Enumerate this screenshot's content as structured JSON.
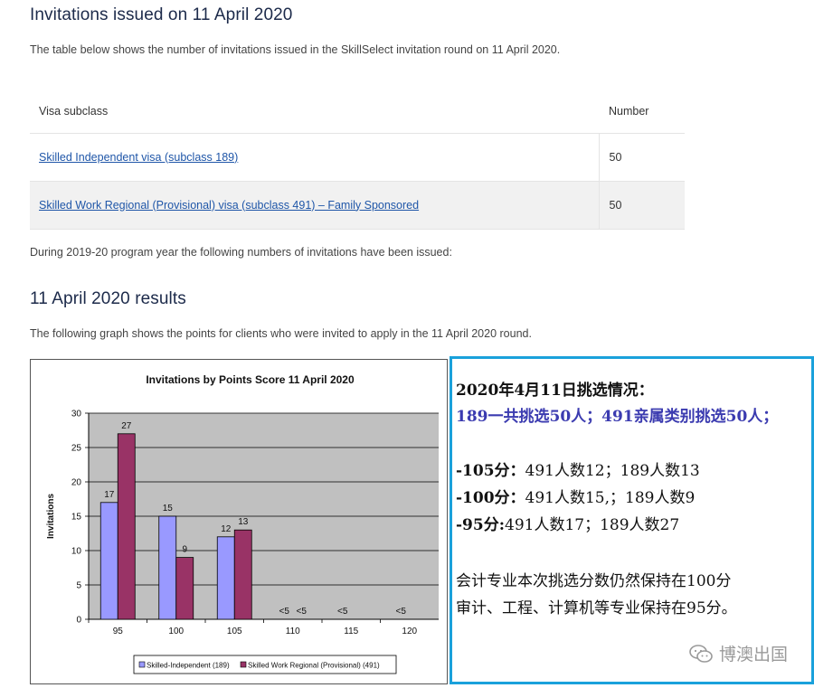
{
  "section1": {
    "title": "Invitations issued on 11 April 2020",
    "intro": "The table below shows the number of invitations issued in the SkillSelect invitation round on 11 April 2020.",
    "table": {
      "headers": [
        "Visa subclass",
        "Number"
      ],
      "rows": [
        {
          "visa": "Skilled Independent visa (subclass 189)",
          "number": "50"
        },
        {
          "visa": "Skilled Work Regional (Provisional) visa (subclass 491) – Family Sponsored",
          "number": "50"
        }
      ]
    },
    "program_note": "During 2019-20 program year the following numbers of invitations have been issued:"
  },
  "section2": {
    "title": "11 April 2020 results",
    "intro": "The following graph shows the points for clients who were invited to apply in the 11 April 2020 round."
  },
  "chart_data": {
    "type": "bar",
    "title": "Invitations by Points Score 11 April 2020",
    "ylabel": "Invitations",
    "xlabel": "",
    "ylim": [
      0,
      30
    ],
    "yticks": [
      0,
      5,
      10,
      15,
      20,
      25,
      30
    ],
    "categories": [
      "95",
      "100",
      "105",
      "110",
      "115",
      "120"
    ],
    "series": [
      {
        "name": "Skilled-Independent (189)",
        "color": "#9999ff",
        "values": [
          17,
          15,
          12,
          null,
          null,
          null
        ],
        "labels": [
          "17",
          "15",
          "12",
          "<5",
          "<5",
          "<5"
        ]
      },
      {
        "name": "Skilled Work Regional (Provisional) (491)",
        "color": "#993366",
        "values": [
          27,
          9,
          13,
          null,
          null,
          null
        ],
        "labels": [
          "27",
          "9",
          "13",
          "<5",
          "",
          ""
        ]
      }
    ],
    "grid": true,
    "legend_position": "bottom",
    "plot_background": "#c0c0c0"
  },
  "notes": {
    "line1": "2020年4月11日挑选情况：",
    "line2": "189一共挑选50人；491亲属类别挑选50人；",
    "line3_label": "-105分：",
    "line3_text": "491人数12；189人数13",
    "line4_label": "-100分：",
    "line4_text": "491人数15,；189人数9",
    "line5_label": "-95分:",
    "line5_text": "491人数17；189人数27",
    "line6": "会计专业本次挑选分数仍然保持在100分",
    "line7": "审计、工程、计算机等专业保持在95分。",
    "watermark": "博澳出国",
    "watermark_icon": "wechat-icon"
  },
  "colors": {
    "heading": "#1c2a4a",
    "link": "#1f56a8",
    "note_border": "#1aa1db",
    "note_blue": "#3b3bb0"
  }
}
